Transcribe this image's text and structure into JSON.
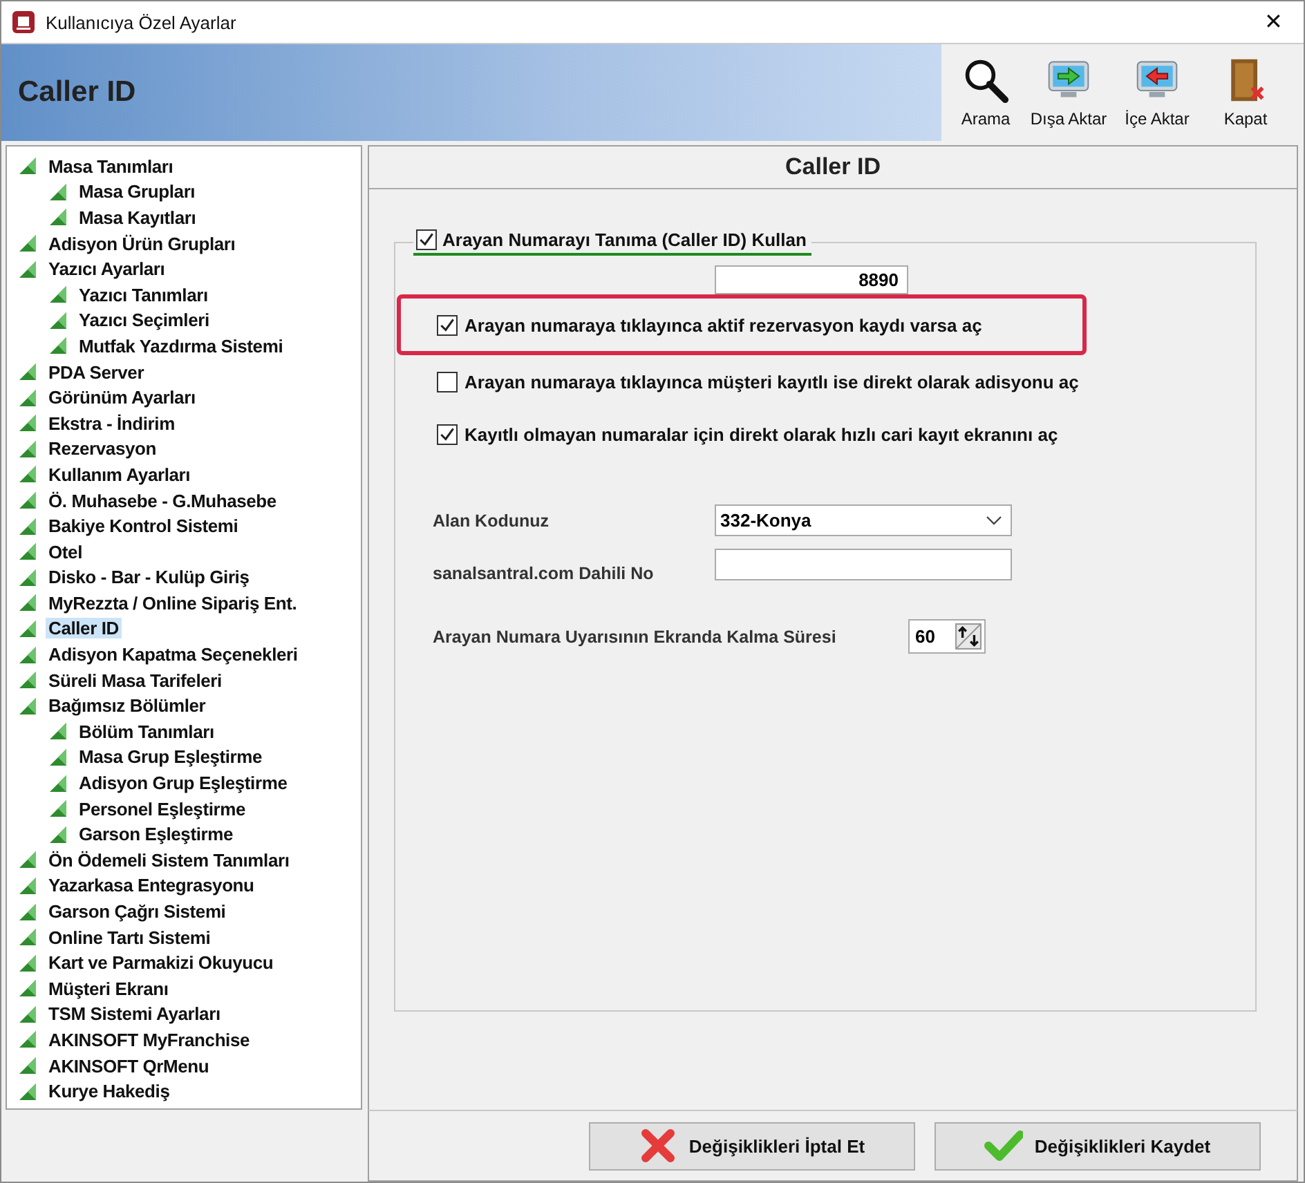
{
  "window": {
    "title": "Kullanıcıya Özel Ayarlar",
    "close": "✕"
  },
  "header": {
    "title": "Caller ID"
  },
  "toolbar": [
    {
      "label": "Arama",
      "kind": "search"
    },
    {
      "label": "Dışa Aktar",
      "kind": "export"
    },
    {
      "label": "İçe Aktar",
      "kind": "import"
    },
    {
      "label": "Kapat",
      "kind": "exit"
    }
  ],
  "sidebar": {
    "items": [
      {
        "label": "Masa Tanımları",
        "selected": false,
        "children": [
          {
            "label": "Masa Grupları",
            "selected": false
          },
          {
            "label": "Masa Kayıtları",
            "selected": false
          }
        ]
      },
      {
        "label": "Adisyon Ürün Grupları",
        "selected": false
      },
      {
        "label": "Yazıcı Ayarları",
        "selected": false,
        "children": [
          {
            "label": "Yazıcı Tanımları",
            "selected": false
          },
          {
            "label": "Yazıcı Seçimleri",
            "selected": false
          },
          {
            "label": "Mutfak Yazdırma Sistemi",
            "selected": false
          }
        ]
      },
      {
        "label": "PDA Server",
        "selected": false
      },
      {
        "label": "Görünüm Ayarları",
        "selected": false
      },
      {
        "label": "Ekstra - İndirim",
        "selected": false
      },
      {
        "label": "Rezervasyon",
        "selected": false
      },
      {
        "label": "Kullanım Ayarları",
        "selected": false
      },
      {
        "label": "Ö. Muhasebe - G.Muhasebe",
        "selected": false
      },
      {
        "label": "Bakiye Kontrol Sistemi",
        "selected": false
      },
      {
        "label": "Otel",
        "selected": false
      },
      {
        "label": "Disko - Bar - Kulüp Giriş",
        "selected": false
      },
      {
        "label": "MyRezzta / Online Sipariş Ent.",
        "selected": false
      },
      {
        "label": "Caller ID",
        "selected": true
      },
      {
        "label": "Adisyon Kapatma Seçenekleri",
        "selected": false
      },
      {
        "label": "Süreli Masa Tarifeleri",
        "selected": false
      },
      {
        "label": "Bağımsız Bölümler",
        "selected": false,
        "children": [
          {
            "label": "Bölüm Tanımları",
            "selected": false
          },
          {
            "label": "Masa Grup Eşleştirme",
            "selected": false
          },
          {
            "label": "Adisyon Grup Eşleştirme",
            "selected": false
          },
          {
            "label": "Personel Eşleştirme",
            "selected": false
          },
          {
            "label": "Garson Eşleştirme",
            "selected": false
          }
        ]
      },
      {
        "label": "Ön Ödemeli Sistem Tanımları",
        "selected": false
      },
      {
        "label": "Yazarkasa Entegrasyonu",
        "selected": false
      },
      {
        "label": "Garson Çağrı Sistemi",
        "selected": false
      },
      {
        "label": "Online Tartı Sistemi",
        "selected": false
      },
      {
        "label": "Kart ve Parmakizi Okuyucu",
        "selected": false
      },
      {
        "label": "Müşteri Ekranı",
        "selected": false
      },
      {
        "label": "TSM Sistemi Ayarları",
        "selected": false
      },
      {
        "label": "AKINSOFT MyFranchise",
        "selected": false
      },
      {
        "label": "AKINSOFT QrMenu",
        "selected": false
      },
      {
        "label": "Kurye Hakediş",
        "selected": false
      }
    ]
  },
  "panel": {
    "title": "Caller ID",
    "group": {
      "label": "Arayan Numarayı Tanıma (Caller ID) Kullan",
      "checked": true,
      "number": "8890",
      "options": [
        {
          "label": "Arayan numaraya tıklayınca aktif rezervasyon kaydı varsa aç",
          "checked": true,
          "highlighted": true
        },
        {
          "label": "Arayan numaraya tıklayınca müşteri kayıtlı ise direkt olarak adisyonu aç",
          "checked": false,
          "highlighted": false
        },
        {
          "label": "Kayıtlı olmayan numaralar için direkt olarak hızlı cari kayıt ekranını aç",
          "checked": true,
          "highlighted": false
        }
      ],
      "fields": [
        {
          "label": "Alan Kodunuz",
          "kind": "select",
          "value": "332-Konya"
        },
        {
          "label": "sanalsantral.com Dahili No",
          "kind": "text"
        },
        {
          "label": "Arayan Numara Uyarısının Ekranda Kalma Süresi",
          "kind": "spinner",
          "value": "60"
        }
      ]
    }
  },
  "buttons": [
    {
      "label": "Değişiklikleri İptal Et",
      "kind": "cancel"
    },
    {
      "label": "Değişiklikleri Kaydet",
      "kind": "save"
    }
  ]
}
